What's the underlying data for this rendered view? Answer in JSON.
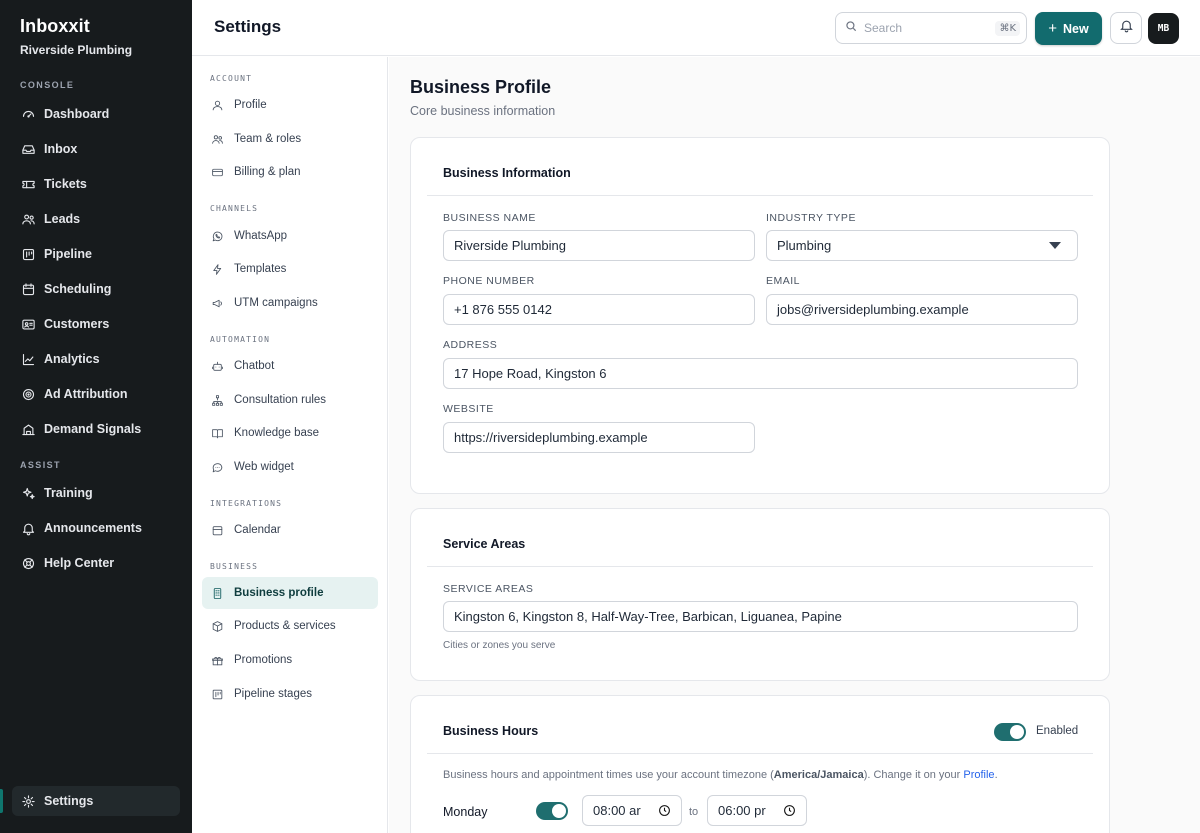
{
  "app": {
    "name": "Inboxxit",
    "workspace": "Riverside Plumbing"
  },
  "sidebar": {
    "sections": [
      {
        "label": "CONSOLE"
      },
      {
        "label": "ASSIST"
      }
    ],
    "items": [
      {
        "label": "Dashboard",
        "icon": "dashboard-icon"
      },
      {
        "label": "Inbox",
        "icon": "inbox-icon"
      },
      {
        "label": "Tickets",
        "icon": "ticket-icon"
      },
      {
        "label": "Leads",
        "icon": "users-icon"
      },
      {
        "label": "Pipeline",
        "icon": "pipeline-icon"
      },
      {
        "label": "Scheduling",
        "icon": "calendar-icon"
      },
      {
        "label": "Customers",
        "icon": "contact-card-icon"
      },
      {
        "label": "Analytics",
        "icon": "chart-line-icon"
      },
      {
        "label": "Ad Attribution",
        "icon": "target-icon"
      },
      {
        "label": "Demand Signals",
        "icon": "building-icon"
      },
      {
        "label": "Training",
        "icon": "sparkles-icon"
      },
      {
        "label": "Announcements",
        "icon": "bell-icon"
      },
      {
        "label": "Help Center",
        "icon": "lifebuoy-icon"
      }
    ],
    "settings_label": "Settings"
  },
  "header": {
    "title": "Settings",
    "search_placeholder": "Search",
    "search_shortcut": "⌘K",
    "new_label": "New",
    "avatar_initials": "MB"
  },
  "subnav": {
    "sections": [
      "ACCOUNT",
      "CHANNELS",
      "AUTOMATION",
      "INTEGRATIONS",
      "BUSINESS"
    ],
    "items": [
      {
        "label": "Profile"
      },
      {
        "label": "Team & roles"
      },
      {
        "label": "Billing & plan"
      },
      {
        "label": "WhatsApp"
      },
      {
        "label": "Templates"
      },
      {
        "label": "UTM campaigns"
      },
      {
        "label": "Chatbot"
      },
      {
        "label": "Consultation rules"
      },
      {
        "label": "Knowledge base"
      },
      {
        "label": "Web widget"
      },
      {
        "label": "Calendar"
      },
      {
        "label": "Business profile"
      },
      {
        "label": "Products & services"
      },
      {
        "label": "Promotions"
      },
      {
        "label": "Pipeline stages"
      }
    ]
  },
  "main": {
    "title": "Business Profile",
    "subtitle": "Core business information",
    "business_info": {
      "title": "Business Information",
      "business_name_label": "BUSINESS NAME",
      "business_name": "Riverside Plumbing",
      "industry_label": "INDUSTRY TYPE",
      "industry": "Plumbing",
      "phone_label": "PHONE NUMBER",
      "phone": "+1 876 555 0142",
      "email_label": "EMAIL",
      "email": "jobs@riversideplumbing.example",
      "address_label": "ADDRESS",
      "address": "17 Hope Road, Kingston 6",
      "website_label": "WEBSITE",
      "website": "https://riversideplumbing.example"
    },
    "service_areas": {
      "title": "Service Areas",
      "label": "SERVICE AREAS",
      "value": "Kingston 6, Kingston 8, Half-Way-Tree, Barbican, Liguanea, Papine",
      "helper": "Cities or zones you serve"
    },
    "hours": {
      "title": "Business Hours",
      "enabled_label": "Enabled",
      "note_prefix": "Business hours and appointment times use your account timezone (",
      "timezone": "America/Jamaica",
      "note_mid": "). Change it on your ",
      "note_link": "Profile",
      "note_suffix": ".",
      "days": [
        {
          "day": "Monday",
          "open": "08:00 ar",
          "close": "06:00 pr",
          "to": "to"
        }
      ]
    }
  },
  "colors": {
    "accent": "#126b6e",
    "sidebar_bg": "#171b1d",
    "active_subnav_bg": "#e6f2f1",
    "link": "#2563eb"
  }
}
